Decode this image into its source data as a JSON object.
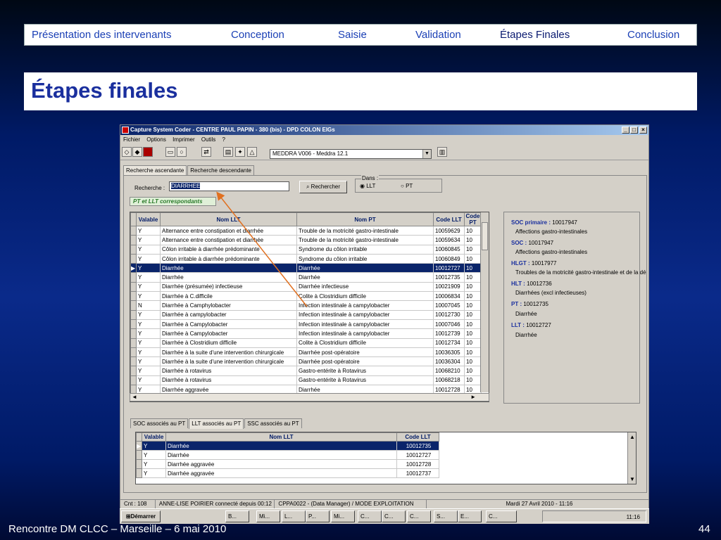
{
  "nav": [
    "Présentation des intervenants",
    "Conception",
    "Saisie",
    "Validation",
    "Étapes Finales",
    "Conclusion"
  ],
  "heading": "Étapes finales",
  "footer": {
    "left": "Rencontre DM CLCC – Marseille – 6 mai 2010",
    "right": "44"
  },
  "window": {
    "title": "Capture System Coder - CENTRE PAUL PAPIN - 380 (bis) - DPD COLON EIGs",
    "menu": [
      "Fichier",
      "Options",
      "Imprimer",
      "Outils",
      "?"
    ],
    "combo": "MEDDRA V006 - Meddra 12.1",
    "tabs": [
      "Recherche ascendante",
      "Recherche descendante"
    ],
    "search": {
      "label": "Recherche :",
      "value": "DIARRHEE",
      "button": "Rechercher",
      "dans_label": "Dans :",
      "opt1": "LLT",
      "opt2": "PT"
    },
    "group_label": "PT et LLT correspondants",
    "grid": {
      "headers": [
        "Valable",
        "Nom LLT",
        "Nom PT",
        "Code LLT",
        "Code PT"
      ],
      "rows": [
        [
          "Y",
          "Alternance entre constipation et diarrhée",
          "Trouble de la motricité gastro-intestinale",
          "10059629",
          "10"
        ],
        [
          "Y",
          "Alternance entre constipation et diarrhée",
          "Trouble de la motricité gastro-intestinale",
          "10059634",
          "10"
        ],
        [
          "Y",
          "Côlon irritable à diarrhée prédominante",
          "Syndrome du côlon irritable",
          "10060845",
          "10"
        ],
        [
          "Y",
          "Côlon irritable à diarrhée prédominante",
          "Syndrome du côlon irritable",
          "10060849",
          "10"
        ],
        [
          "Y",
          "Diarrhée",
          "Diarrhée",
          "10012727",
          "10"
        ],
        [
          "Y",
          "Diarrhée",
          "Diarrhée",
          "10012735",
          "10"
        ],
        [
          "Y",
          "Diarrhée (présumée) infectieuse",
          "Diarrhée infectieuse",
          "10021909",
          "10"
        ],
        [
          "Y",
          "Diarrhée à C.difficile",
          "Colite à Clostridium difficile",
          "10006834",
          "10"
        ],
        [
          "N",
          "Diarrhée à Camphylobacter",
          "Infection intestinale à campylobacter",
          "10007045",
          "10"
        ],
        [
          "Y",
          "Diarrhée à campylobacter",
          "Infection intestinale à campylobacter",
          "10012730",
          "10"
        ],
        [
          "Y",
          "Diarrhée à Campylobacter",
          "Infection intestinale à campylobacter",
          "10007046",
          "10"
        ],
        [
          "Y",
          "Diarrhée à Campylobacter",
          "Infection intestinale à campylobacter",
          "10012739",
          "10"
        ],
        [
          "Y",
          "Diarrhée à Clostridium difficile",
          "Colite à Clostridium difficile",
          "10012734",
          "10"
        ],
        [
          "Y",
          "Diarrhée à la suite d'une intervention chirurgicale",
          "Diarrhée post-opératoire",
          "10036305",
          "10"
        ],
        [
          "Y",
          "Diarrhée à la suite d'une intervention chirurgicale",
          "Diarrhée post-opératoire",
          "10036304",
          "10"
        ],
        [
          "Y",
          "Diarrhée à rotavirus",
          "Gastro-entérite à Rotavirus",
          "10068210",
          "10"
        ],
        [
          "Y",
          "Diarrhée à rotavirus",
          "Gastro-entérite à Rotavirus",
          "10068218",
          "10"
        ],
        [
          "Y",
          "Diarrhée aggravée",
          "Diarrhée",
          "10012728",
          "10"
        ]
      ]
    },
    "info": {
      "soc_primaire_k": "SOC primaire :",
      "soc_primaire_v": "10017947",
      "soc_primaire_t": "Affections gastro-intestinales",
      "soc_k": "SOC :",
      "soc_v": "10017947",
      "soc_t": "Affections gastro-intestinales",
      "hlgt_k": "HLGT :",
      "hlgt_v": "10017977",
      "hlgt_t": "Troubles de la motricité gastro-intestinale et de la dé",
      "hlt_k": "HLT :",
      "hlt_v": "10012736",
      "hlt_t": "Diarrhées (excl infectieuses)",
      "pt_k": "PT :",
      "pt_v": "10012735",
      "pt_t": "Diarrhée",
      "llt_k": "LLT :",
      "llt_v": "10012727",
      "llt_t": "Diarrhée"
    },
    "tabs2": [
      "SOC associés au PT",
      "LLT associés au PT",
      "SSC associés au PT"
    ],
    "grid2": {
      "headers": [
        "Valable",
        "Nom LLT",
        "Code LLT"
      ],
      "rows": [
        [
          "Y",
          "Diarrhée",
          "10012735"
        ],
        [
          "Y",
          "Diarrhée",
          "10012727"
        ],
        [
          "Y",
          "Diarrhée aggravée",
          "10012728"
        ],
        [
          "Y",
          "Diarrhée aggravée",
          "10012737"
        ]
      ]
    },
    "status": [
      "Cnt : 108",
      "ANNE-LISE POIRIER connecté depuis 00:12",
      "CPPA0022 - (Data Manager)  / MODE EXPLOITATION",
      "Mardi 27 Avril 2010  -  11:16"
    ]
  },
  "taskbar": {
    "start": "Démarrer",
    "tasks": [
      "B...",
      "Mi...",
      "L...",
      "P...",
      "Mi...",
      "C...",
      "C...",
      "C...",
      "S...",
      "E...",
      "C..."
    ],
    "clock": "11:16"
  }
}
